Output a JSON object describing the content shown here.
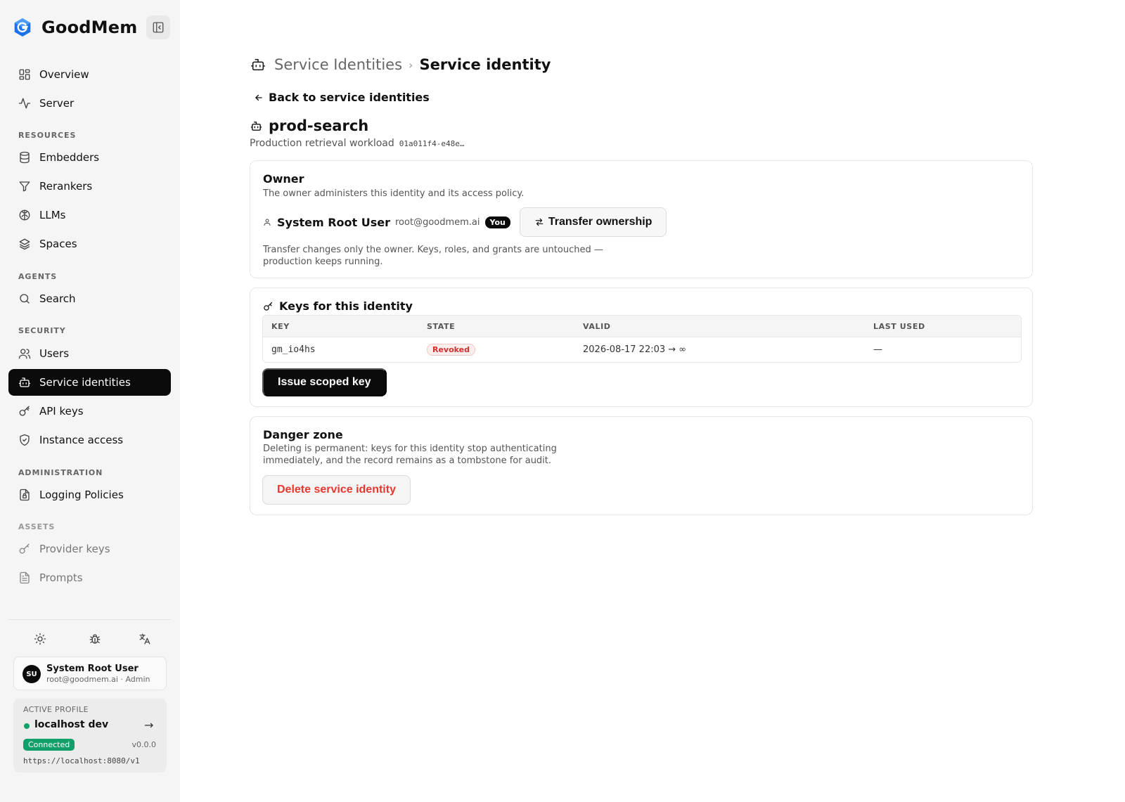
{
  "app": {
    "name": "GoodMem"
  },
  "sidebar": {
    "items": [
      {
        "label": "Overview",
        "icon": "grid-icon"
      },
      {
        "label": "Server",
        "icon": "activity-icon"
      }
    ],
    "sections": [
      {
        "label": "RESOURCES",
        "items": [
          {
            "label": "Embedders",
            "icon": "database-icon"
          },
          {
            "label": "Rerankers",
            "icon": "filter-icon"
          },
          {
            "label": "LLMs",
            "icon": "brain-icon"
          },
          {
            "label": "Spaces",
            "icon": "layers-icon"
          }
        ]
      },
      {
        "label": "AGENTS",
        "items": [
          {
            "label": "Search",
            "icon": "search-icon"
          }
        ]
      },
      {
        "label": "SECURITY",
        "items": [
          {
            "label": "Users",
            "icon": "users-icon"
          },
          {
            "label": "Service identities",
            "icon": "bot-icon",
            "active": true
          },
          {
            "label": "API keys",
            "icon": "key-icon"
          },
          {
            "label": "Instance access",
            "icon": "shield-icon"
          }
        ]
      },
      {
        "label": "ADMINISTRATION",
        "items": [
          {
            "label": "Logging Policies",
            "icon": "file-lock-icon"
          }
        ]
      },
      {
        "label": "ASSETS",
        "items": [
          {
            "label": "Provider keys",
            "icon": "key-round-icon"
          },
          {
            "label": "Prompts",
            "icon": "file-text-icon"
          }
        ]
      }
    ],
    "utility_icons": [
      "sun-icon",
      "bug-icon",
      "translate-icon"
    ],
    "user": {
      "initials": "SU",
      "name": "System Root User",
      "meta": "root@goodmem.ai · Admin"
    },
    "profile": {
      "label": "ACTIVE PROFILE",
      "name": "localhost dev",
      "status": "Connected",
      "status_color": "#12a06a",
      "version": "v0.0.0",
      "url": "https://localhost:8080/v1"
    }
  },
  "breadcrumb": {
    "parent": "Service Identities",
    "separator": "›",
    "current": "Service identity"
  },
  "back_link": "Back to service identities",
  "identity": {
    "name": "prod-search",
    "description": "Production retrieval workload",
    "id_truncated": "01a011f4-e48e…"
  },
  "owner": {
    "title": "Owner",
    "description": "The owner administers this identity and its access policy.",
    "user_name": "System Root User",
    "user_email": "root@goodmem.ai",
    "you_badge": "You",
    "transfer_label": "Transfer ownership",
    "note_line1": "Transfer changes only the owner. Keys, roles, and grants are untouched —",
    "note_line2": "production keeps running."
  },
  "keys": {
    "title": "Keys for this identity",
    "columns": [
      "KEY",
      "STATE",
      "VALID",
      "LAST USED"
    ],
    "rows": [
      {
        "key": "gm_io4hs",
        "state": "Revoked",
        "valid": "2026-08-17 22:03 → ∞",
        "last_used": "—"
      }
    ],
    "issue_label": "Issue scoped key"
  },
  "danger": {
    "title": "Danger zone",
    "line1": "Deleting is permanent: keys for this identity stop authenticating",
    "line2": "immediately, and the record remains as a tombstone for audit.",
    "delete_label": "Delete service identity",
    "delete_color": "#e5382f"
  }
}
